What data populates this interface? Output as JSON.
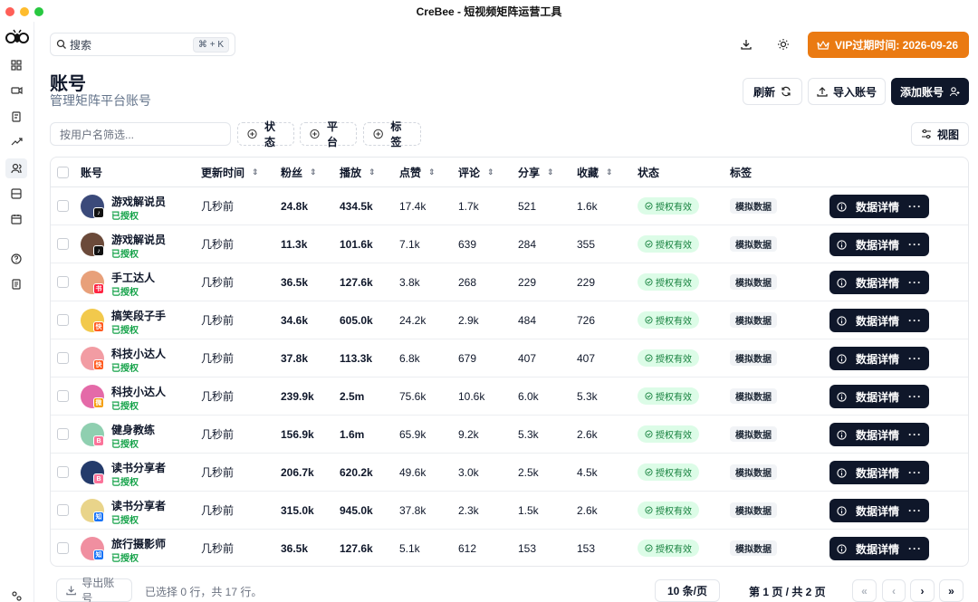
{
  "window": {
    "title": "CreBee - 短视频矩阵运营工具",
    "traffic_colors": [
      "#ff5f57",
      "#febc2e",
      "#28c840"
    ]
  },
  "rail": {
    "icons": [
      "grid-icon",
      "video-icon",
      "clipboard-icon",
      "trending-icon",
      "users-icon",
      "server-icon",
      "calendar-icon",
      "help-icon",
      "document-icon"
    ]
  },
  "topbar": {
    "search_label": "搜索",
    "search_shortcut": "⌘ + K",
    "vip_label": "VIP过期时间: 2026-09-26",
    "vip_color": "#ea7a12"
  },
  "header": {
    "title": "账号",
    "subtitle": "管理矩阵平台账号",
    "refresh_label": "刷新",
    "import_label": "导入账号",
    "add_label": "添加账号"
  },
  "filters": {
    "username_placeholder": "按用户名筛选...",
    "status_label": "状态",
    "platform_label": "平台",
    "tags_label": "标签",
    "view_label": "视图"
  },
  "table": {
    "columns": [
      "账号",
      "更新时间",
      "粉丝",
      "播放",
      "点赞",
      "评论",
      "分享",
      "收藏",
      "状态",
      "标签"
    ],
    "detail_label": "数据详情",
    "rows": [
      {
        "name": "游戏解说员",
        "auth": "已授权",
        "time": "几秒前",
        "fans": "24.8k",
        "plays": "434.5k",
        "likes": "17.4k",
        "comments": "1.7k",
        "shares": "521",
        "favs": "1.6k",
        "status": "授权有效",
        "tag": "模拟数据",
        "platform": "douyin",
        "platform_color": "#111111",
        "avatar_color": "#3b4a7a"
      },
      {
        "name": "游戏解说员",
        "auth": "已授权",
        "time": "几秒前",
        "fans": "11.3k",
        "plays": "101.6k",
        "likes": "7.1k",
        "comments": "639",
        "shares": "284",
        "favs": "355",
        "status": "授权有效",
        "tag": "模拟数据",
        "platform": "douyin",
        "platform_color": "#111111",
        "avatar_color": "#6b4a3a"
      },
      {
        "name": "手工达人",
        "auth": "已授权",
        "time": "几秒前",
        "fans": "36.5k",
        "plays": "127.6k",
        "likes": "3.8k",
        "comments": "268",
        "shares": "229",
        "favs": "229",
        "status": "授权有效",
        "tag": "模拟数据",
        "platform": "xiaohongshu",
        "platform_color": "#ff2442",
        "avatar_color": "#e8a07a"
      },
      {
        "name": "搞笑段子手",
        "auth": "已授权",
        "time": "几秒前",
        "fans": "34.6k",
        "plays": "605.0k",
        "likes": "24.2k",
        "comments": "2.9k",
        "shares": "484",
        "favs": "726",
        "status": "授权有效",
        "tag": "模拟数据",
        "platform": "kuaishou",
        "platform_color": "#ff5a1f",
        "avatar_color": "#f2c94c"
      },
      {
        "name": "科技小达人",
        "auth": "已授权",
        "time": "几秒前",
        "fans": "37.8k",
        "plays": "113.3k",
        "likes": "6.8k",
        "comments": "679",
        "shares": "407",
        "favs": "407",
        "status": "授权有效",
        "tag": "模拟数据",
        "platform": "kuaishou",
        "platform_color": "#ff5a1f",
        "avatar_color": "#f29ca3"
      },
      {
        "name": "科技小达人",
        "auth": "已授权",
        "time": "几秒前",
        "fans": "239.9k",
        "plays": "2.5m",
        "likes": "75.6k",
        "comments": "10.6k",
        "shares": "6.0k",
        "favs": "5.3k",
        "status": "授权有效",
        "tag": "模拟数据",
        "platform": "weishi",
        "platform_color": "#f59e0b",
        "avatar_color": "#e46aa8"
      },
      {
        "name": "健身教练",
        "auth": "已授权",
        "time": "几秒前",
        "fans": "156.9k",
        "plays": "1.6m",
        "likes": "65.9k",
        "comments": "9.2k",
        "shares": "5.3k",
        "favs": "2.6k",
        "status": "授权有效",
        "tag": "模拟数据",
        "platform": "bilibili",
        "platform_color": "#fb7299",
        "avatar_color": "#8fcfb0"
      },
      {
        "name": "读书分享者",
        "auth": "已授权",
        "time": "几秒前",
        "fans": "206.7k",
        "plays": "620.2k",
        "likes": "49.6k",
        "comments": "3.0k",
        "shares": "2.5k",
        "favs": "4.5k",
        "status": "授权有效",
        "tag": "模拟数据",
        "platform": "bilibili",
        "platform_color": "#fb7299",
        "avatar_color": "#243b6b"
      },
      {
        "name": "读书分享者",
        "auth": "已授权",
        "time": "几秒前",
        "fans": "315.0k",
        "plays": "945.0k",
        "likes": "37.8k",
        "comments": "2.3k",
        "shares": "1.5k",
        "favs": "2.6k",
        "status": "授权有效",
        "tag": "模拟数据",
        "platform": "zhihu",
        "platform_color": "#1772f6",
        "avatar_color": "#e9d48a"
      },
      {
        "name": "旅行摄影师",
        "auth": "已授权",
        "time": "几秒前",
        "fans": "36.5k",
        "plays": "127.6k",
        "likes": "5.1k",
        "comments": "612",
        "shares": "153",
        "favs": "153",
        "status": "授权有效",
        "tag": "模拟数据",
        "platform": "zhihu",
        "platform_color": "#1772f6",
        "avatar_color": "#f08fa0"
      }
    ]
  },
  "footer": {
    "export_label": "导出账号",
    "selection_text": "已选择 0 行，共 17 行。",
    "page_size": "10 条/页",
    "page_info": "第 1 页 / 共 2 页",
    "first": "«",
    "prev": "‹",
    "next": "›",
    "last": "»"
  }
}
